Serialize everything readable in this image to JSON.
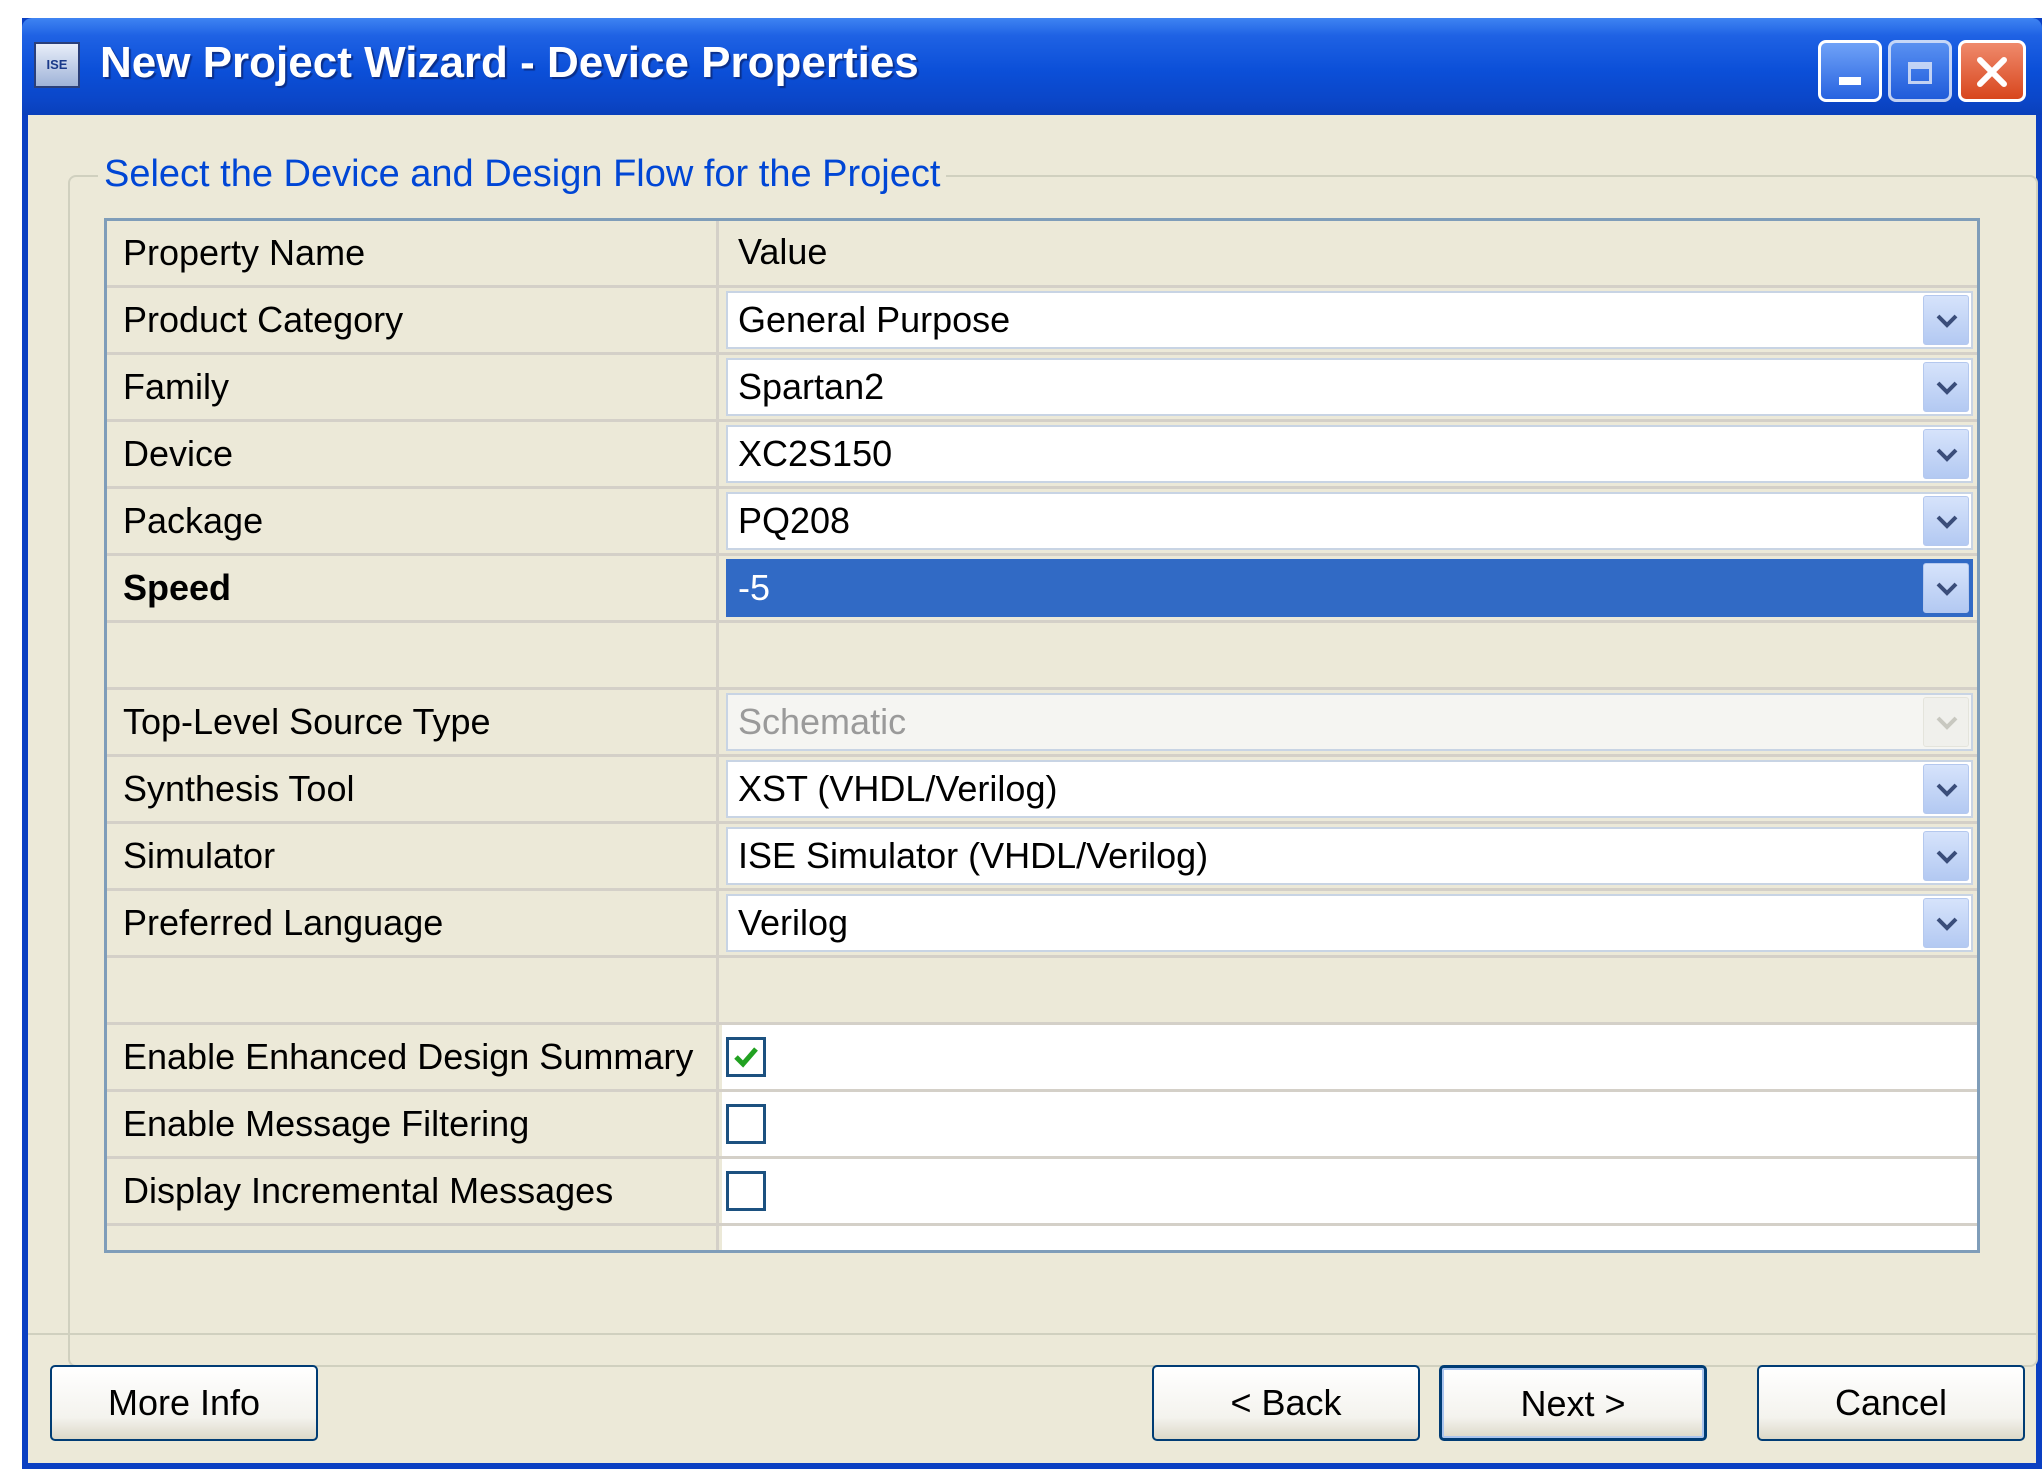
{
  "window": {
    "title": "New Project Wizard - Device Properties",
    "icon_text": "ISE"
  },
  "group": {
    "legend": "Select the Device and Design Flow for the Project"
  },
  "grid": {
    "header": {
      "name": "Property Name",
      "value": "Value"
    },
    "rows": [
      {
        "name": "Product Category",
        "value": "General Purpose"
      },
      {
        "name": "Family",
        "value": "Spartan2"
      },
      {
        "name": "Device",
        "value": "XC2S150"
      },
      {
        "name": "Package",
        "value": "PQ208"
      },
      {
        "name": "Speed",
        "value": "-5"
      },
      {
        "name": "Top-Level Source Type",
        "value": "Schematic"
      },
      {
        "name": "Synthesis Tool",
        "value": "XST (VHDL/Verilog)"
      },
      {
        "name": "Simulator",
        "value": "ISE Simulator (VHDL/Verilog)"
      },
      {
        "name": "Preferred Language",
        "value": "Verilog"
      },
      {
        "name": "Enable Enhanced Design Summary",
        "checked": true
      },
      {
        "name": "Enable Message Filtering",
        "checked": false
      },
      {
        "name": "Display Incremental Messages",
        "checked": false
      }
    ]
  },
  "buttons": {
    "more_info": "More Info",
    "back": "< Back",
    "next": "Next >",
    "cancel": "Cancel"
  },
  "colors": {
    "title_bar": "#0b4fd8",
    "selection": "#316ac5",
    "dialog_bg": "#ece9d8",
    "legend_text": "#0046d5",
    "check_mark": "#21a121"
  }
}
